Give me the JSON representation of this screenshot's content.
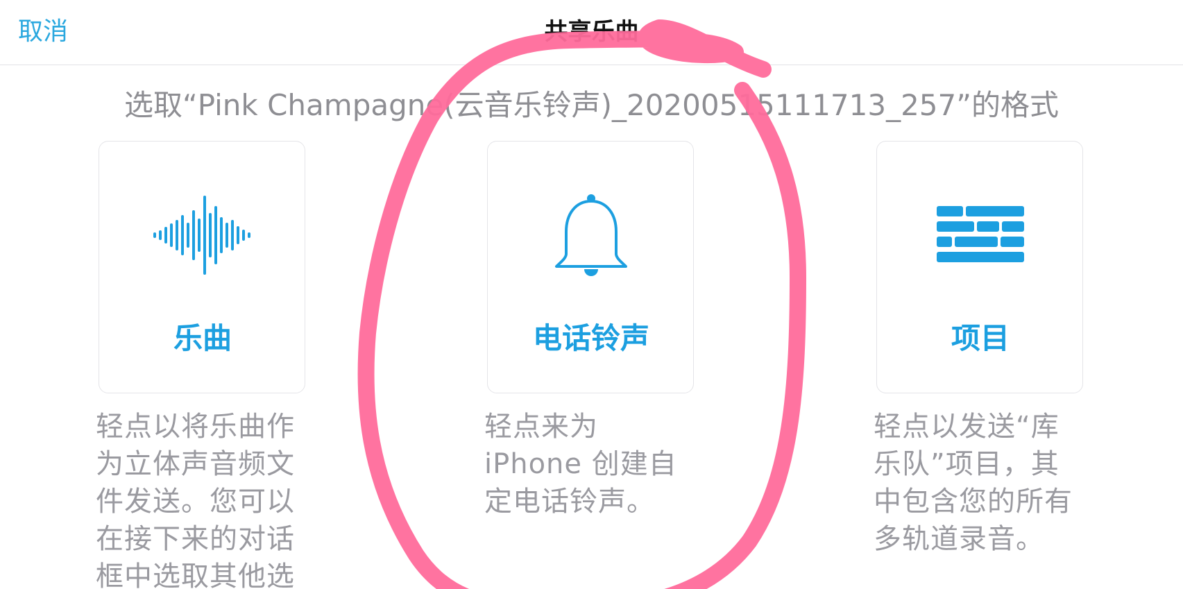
{
  "nav": {
    "cancel_label": "取消",
    "title": "共享乐曲"
  },
  "subtitle": "选取“Pink Champagne(云音乐铃声)_20200515111713_257”的格式",
  "options": [
    {
      "label": "乐曲",
      "icon": "waveform-icon",
      "description_lines": [
        "轻点以将乐曲作",
        "为立体声音频文",
        "件发送。您可以",
        "在接下来的对话",
        "框中选取其他选"
      ]
    },
    {
      "label": "电话铃声",
      "icon": "bell-icon",
      "description_lines": [
        "轻点来为",
        "iPhone 创建自",
        "定电话铃声。"
      ]
    },
    {
      "label": "项目",
      "icon": "bricks-icon",
      "description_lines": [
        "轻点以发送“库",
        "乐队”项目，其",
        "中包含您的所有",
        "多轨道录音。"
      ]
    }
  ],
  "colors": {
    "accent": "#1c9fe0",
    "cancel": "#2ba8df",
    "secondary_text": "#9a9aa0",
    "annotation": "#ff6b9b"
  }
}
